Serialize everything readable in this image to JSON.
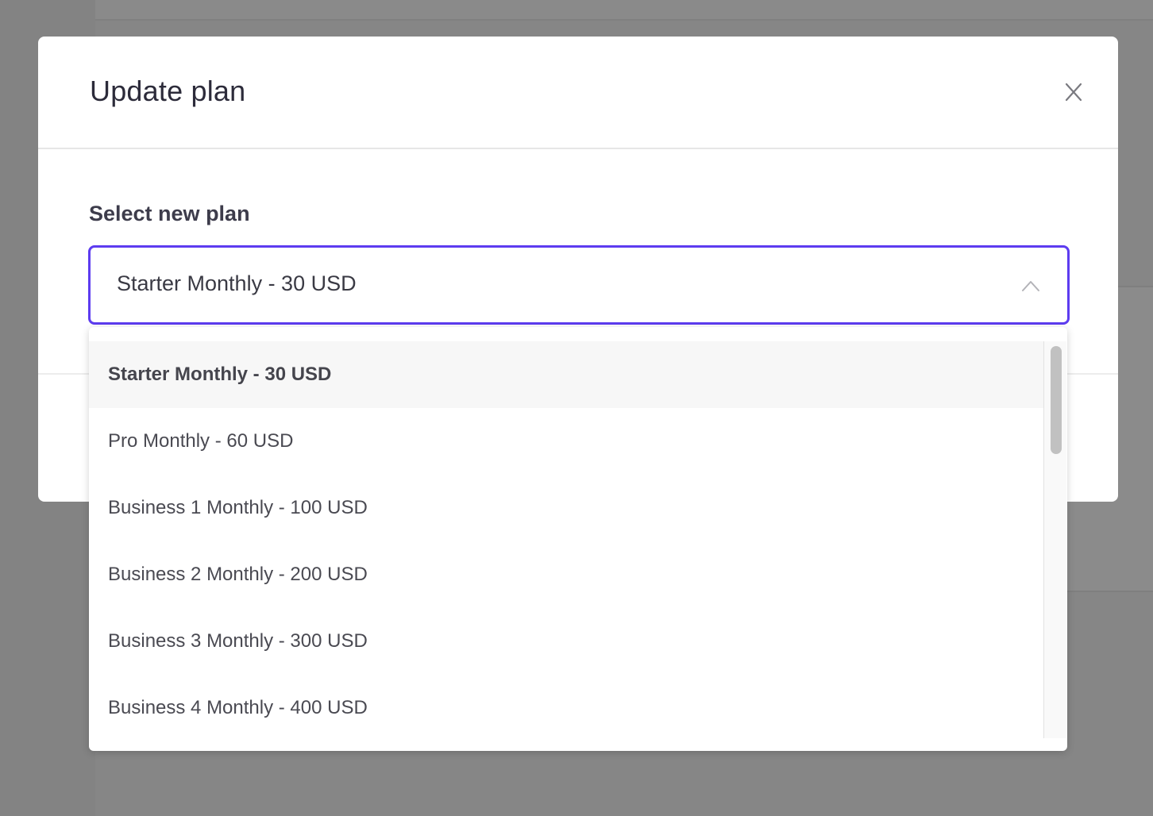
{
  "modal": {
    "title": "Update plan",
    "close_icon": "close-icon"
  },
  "form": {
    "label": "Select new plan",
    "selected_value": "Starter Monthly - 30 USD",
    "chevron_icon": "chevron-up-icon",
    "focus_color": "#5d3cf0"
  },
  "dropdown": {
    "options": [
      {
        "label": "Starter Monthly - 30 USD",
        "selected": true
      },
      {
        "label": "Pro Monthly - 60 USD",
        "selected": false
      },
      {
        "label": "Business 1 Monthly - 100 USD",
        "selected": false
      },
      {
        "label": "Business 2 Monthly - 200 USD",
        "selected": false
      },
      {
        "label": "Business 3 Monthly - 300 USD",
        "selected": false
      },
      {
        "label": "Business 4 Monthly - 400 USD",
        "selected": false
      }
    ]
  }
}
